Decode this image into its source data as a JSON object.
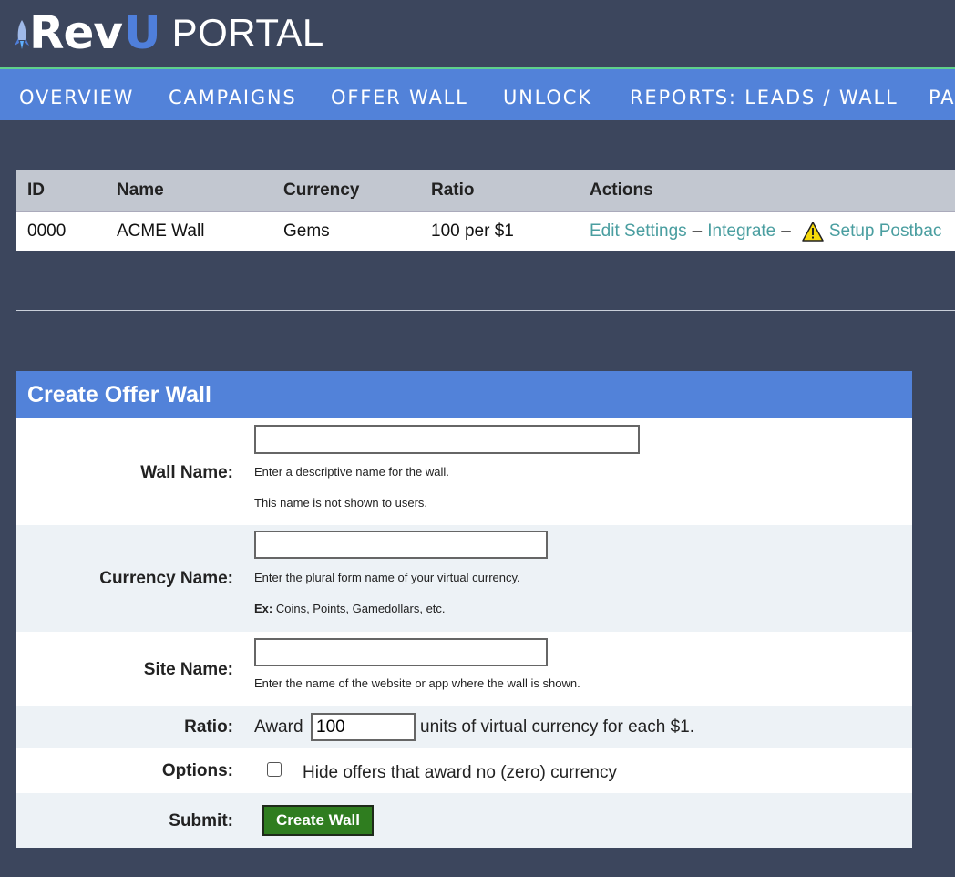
{
  "header": {
    "logo_rev": "Rev",
    "logo_u": "U",
    "logo_portal": "PORTAL"
  },
  "nav": {
    "items": [
      "OVERVIEW",
      "CAMPAIGNS",
      "OFFER WALL",
      "UNLOCK",
      "REPORTS: LEADS / WALL",
      "PA"
    ]
  },
  "walls_table": {
    "headers": [
      "ID",
      "Name",
      "Currency",
      "Ratio",
      "Actions"
    ],
    "rows": [
      {
        "id": "0000",
        "name": "ACME Wall",
        "currency": "Gems",
        "ratio": "100 per $1",
        "actions": {
          "edit": "Edit Settings",
          "sep1": "–",
          "integrate": "Integrate",
          "sep2": "–",
          "setup": "Setup Postbac"
        }
      }
    ]
  },
  "form": {
    "title": "Create Offer Wall",
    "wall_name": {
      "label": "Wall Name:",
      "value": "",
      "help1": "Enter a descriptive name for the wall.",
      "help2": "This name is not shown to users."
    },
    "currency_name": {
      "label": "Currency Name:",
      "value": "",
      "help1": "Enter the plural form name of your virtual currency.",
      "help2_bold": "Ex:",
      "help2": " Coins, Points, Gamedollars, etc."
    },
    "site_name": {
      "label": "Site Name:",
      "value": "",
      "help1": "Enter the name of the website or app where the wall is shown."
    },
    "ratio": {
      "label": "Ratio:",
      "prefix": "Award",
      "value": "100",
      "suffix": "units of virtual currency for each $1."
    },
    "options": {
      "label": "Options:",
      "checkbox_label": "Hide offers that award no (zero) currency",
      "checked": false
    },
    "submit": {
      "label": "Submit:",
      "button": "Create Wall"
    }
  },
  "colors": {
    "background": "#3c465d",
    "nav": "#5282d9",
    "link": "#4a9ea0",
    "button": "#2f7d1f"
  }
}
